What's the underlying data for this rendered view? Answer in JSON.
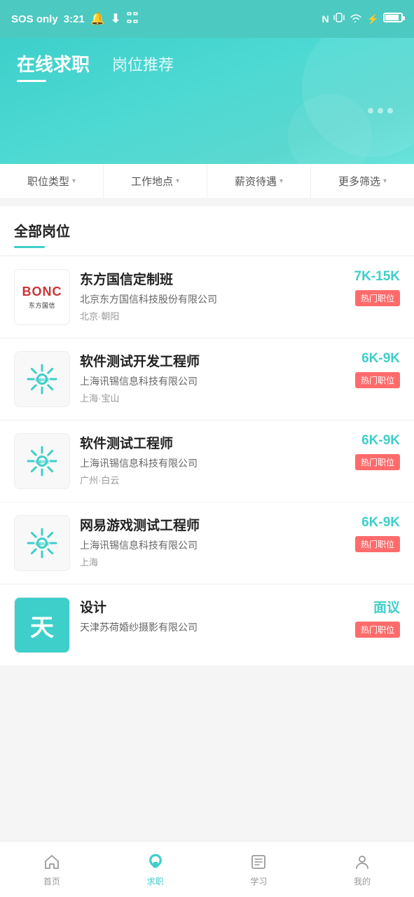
{
  "statusBar": {
    "signal": "SOS only",
    "time": "3:21",
    "icons": [
      "notification",
      "download",
      "screenshot",
      "nfc",
      "vibrate",
      "wifi",
      "battery-saver",
      "battery"
    ]
  },
  "header": {
    "tab_active": "在线求职",
    "tab_inactive": "岗位推荐"
  },
  "filter": {
    "items": [
      "职位类型",
      "工作地点",
      "薪资待遇",
      "更多筛选"
    ]
  },
  "allPositions": {
    "title": "全部岗位"
  },
  "jobs": [
    {
      "id": 1,
      "logo_type": "bonc",
      "logo_text": "BONC",
      "logo_sub": "东方国信",
      "title": "东方国信定制班",
      "company": "北京东方国信科技股份有限公司",
      "location": "北京·朝阳",
      "salary": "7K-15K",
      "badge": "热门职位"
    },
    {
      "id": 2,
      "logo_type": "xunxi",
      "title": "软件测试开发工程师",
      "company": "上海讯锡信息科技有限公司",
      "location": "上海·宝山",
      "salary": "6K-9K",
      "badge": "热门职位"
    },
    {
      "id": 3,
      "logo_type": "xunxi",
      "title": "软件测试工程师",
      "company": "上海讯锡信息科技有限公司",
      "location": "广州·白云",
      "salary": "6K-9K",
      "badge": "热门职位"
    },
    {
      "id": 4,
      "logo_type": "xunxi",
      "title": "网易游戏测试工程师",
      "company": "上海讯锡信息科技有限公司",
      "location": "上海",
      "salary": "6K-9K",
      "badge": "热门职位"
    },
    {
      "id": 5,
      "logo_type": "tian",
      "logo_text": "天",
      "title": "设计",
      "company": "天津苏荷婚纱摄影有限公司",
      "location": "",
      "salary": "面议",
      "badge": "热门职位"
    }
  ],
  "bottomNav": {
    "items": [
      {
        "id": "home",
        "label": "首页",
        "active": false
      },
      {
        "id": "jobs",
        "label": "求职",
        "active": true
      },
      {
        "id": "learn",
        "label": "学习",
        "active": false
      },
      {
        "id": "profile",
        "label": "我的",
        "active": false
      }
    ]
  }
}
